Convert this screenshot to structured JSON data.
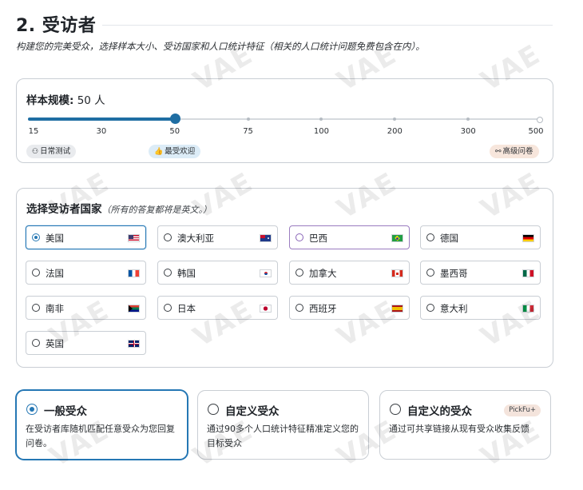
{
  "header": {
    "title": "2. 受访者",
    "subtitle": "构建您的完美受众，选择样本大小、受访国家和人口统计特征（相关的人口统计问题免费包含在内）。"
  },
  "sample": {
    "label": "样本规模:",
    "value_text": "50 人",
    "selected_value": 50,
    "ticks": [
      "15",
      "30",
      "50",
      "75",
      "100",
      "200",
      "300",
      "500"
    ],
    "pills": [
      {
        "icon": "⚇",
        "label": "日常测试"
      },
      {
        "icon": "👍",
        "label": "最受欢迎"
      },
      {
        "icon": "⚯",
        "label": "高级问卷"
      }
    ],
    "track_color": "#1f6ea3"
  },
  "country": {
    "label": "选择受访者国家",
    "note": "（所有的答复都将是英文。）",
    "items": [
      {
        "name": "美国",
        "flag": "us-flag"
      },
      {
        "name": "澳大利亚",
        "flag": "au-flag"
      },
      {
        "name": "巴西",
        "flag": "br-flag"
      },
      {
        "name": "德国",
        "flag": "de-flag"
      },
      {
        "name": "法国",
        "flag": "fr-flag"
      },
      {
        "name": "韩国",
        "flag": "kr-flag"
      },
      {
        "name": "加拿大",
        "flag": "ca-flag"
      },
      {
        "name": "墨西哥",
        "flag": "mx-flag"
      },
      {
        "name": "南非",
        "flag": "za-flag"
      },
      {
        "name": "日本",
        "flag": "jp-flag"
      },
      {
        "name": "西班牙",
        "flag": "es-flag"
      },
      {
        "name": "意大利",
        "flag": "it-flag"
      },
      {
        "name": "英国",
        "flag": "gb-flag"
      }
    ],
    "selected": "美国",
    "hovered": "巴西"
  },
  "audience": {
    "options": [
      {
        "title": "一般受众",
        "desc": "在受访者库随机匹配任意受众为您回复问卷。",
        "selected": true
      },
      {
        "title": "自定义受众",
        "desc": "通过90多个人口统计特征精准定义您的目标受众",
        "selected": false
      },
      {
        "title": "自定义的受众",
        "desc": "通过可共享链接从现有受众收集反馈",
        "badge": "PickFu+",
        "selected": false
      }
    ]
  },
  "watermark": "VAE",
  "colors": {
    "accent": "#2577b4",
    "badge_bg": "#f4e4dc"
  }
}
